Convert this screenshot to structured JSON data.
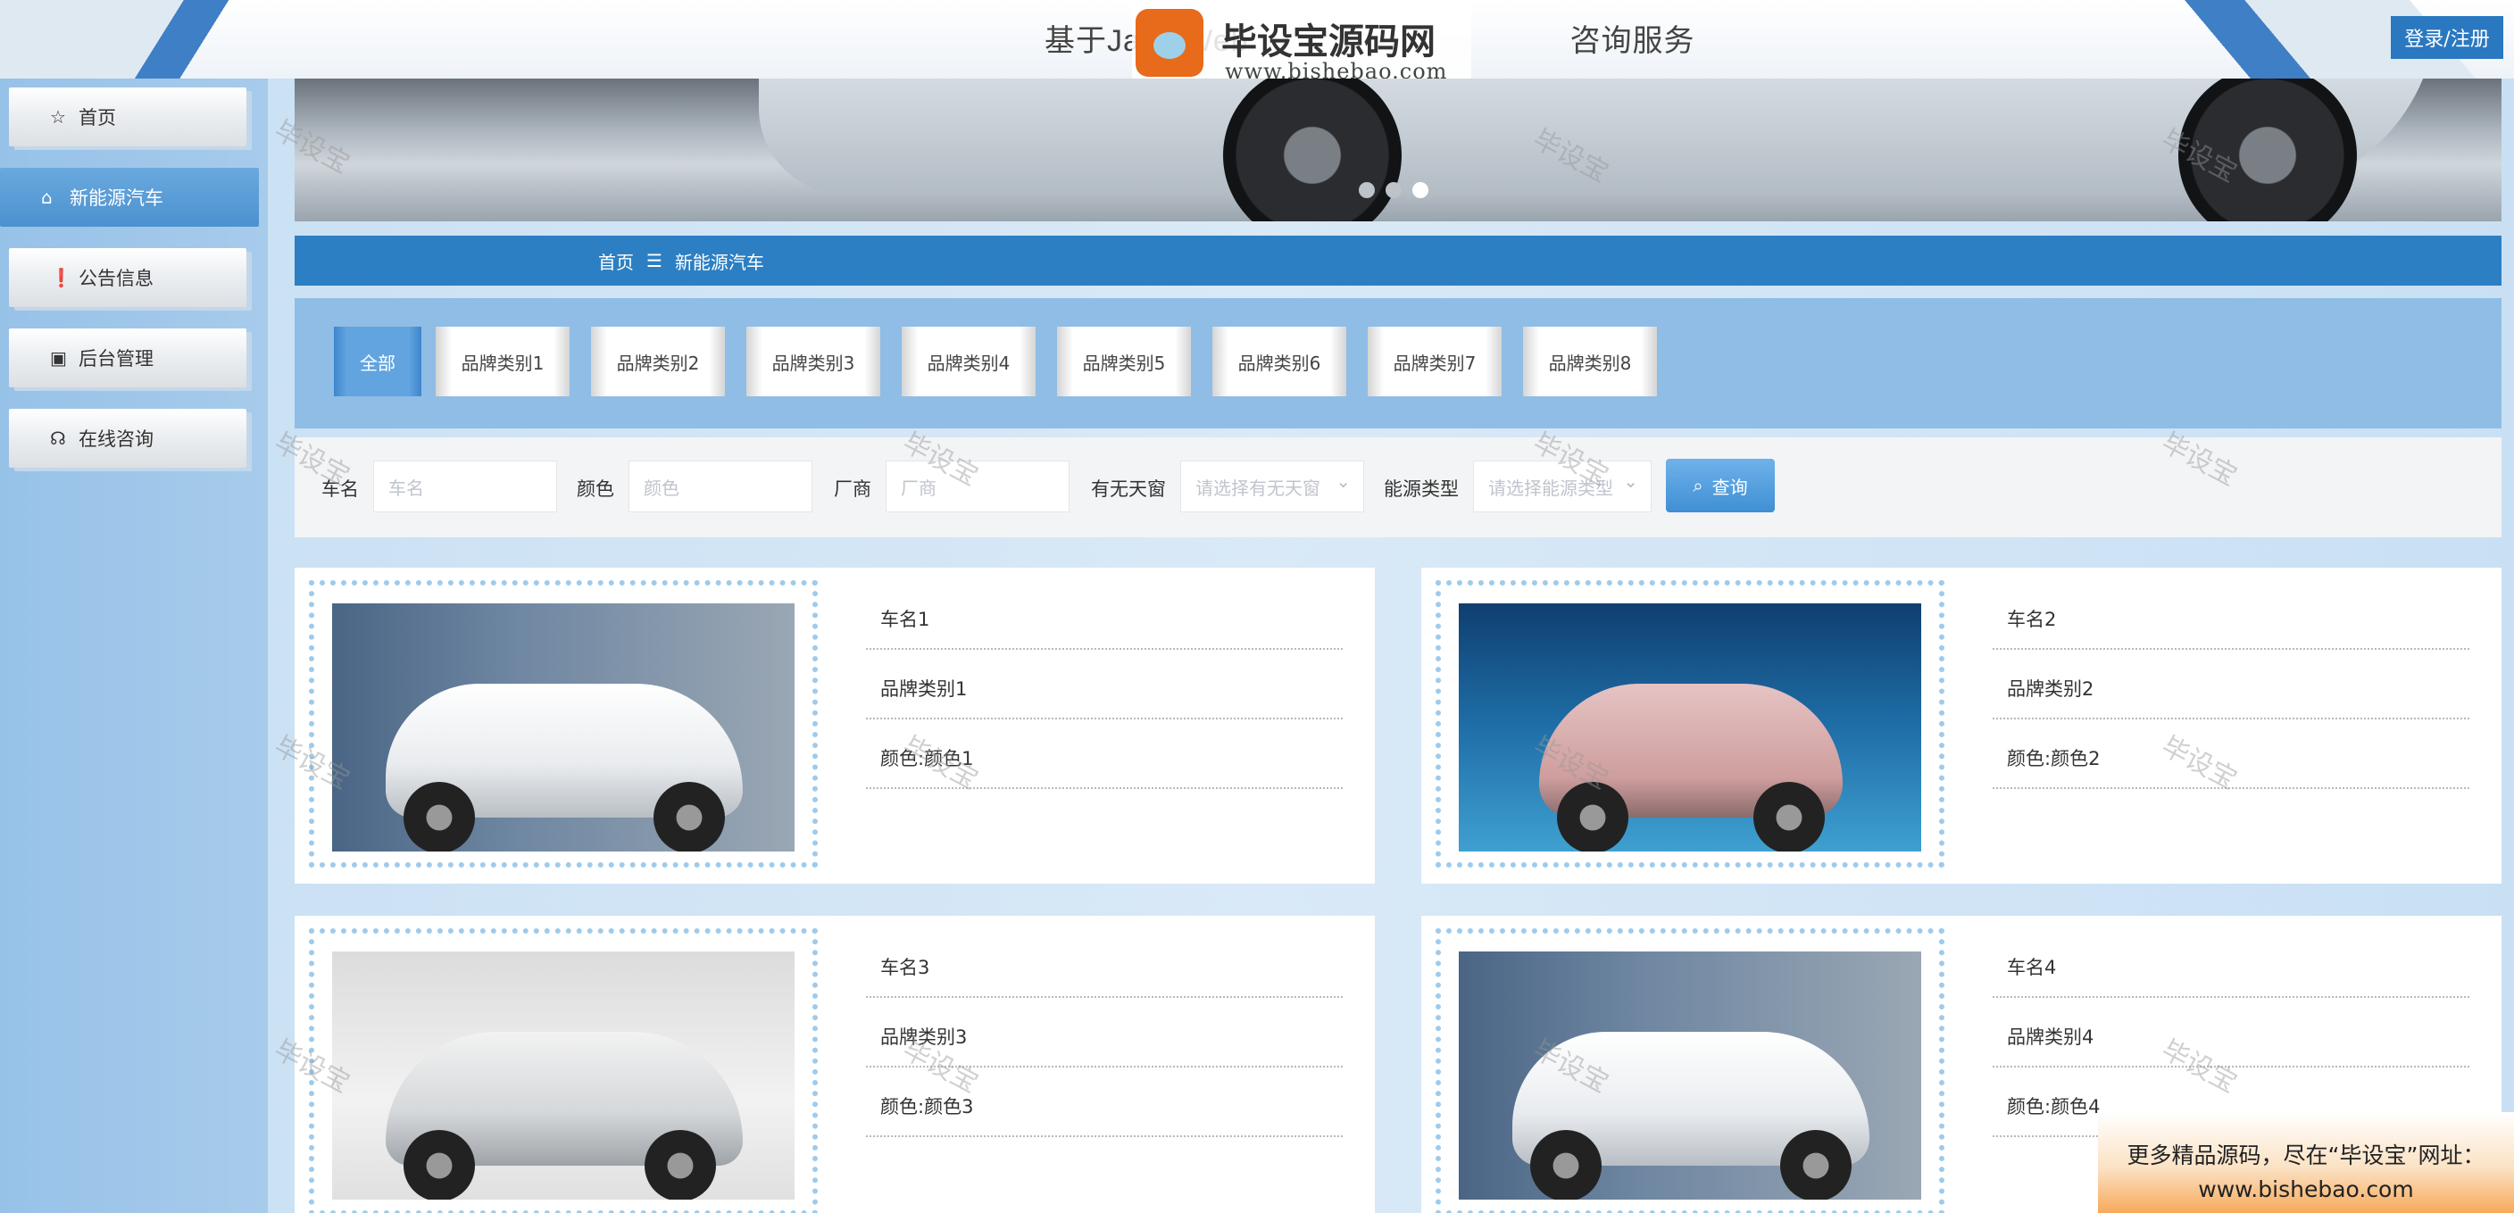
{
  "header": {
    "title": "基于Java Web",
    "title_tail": "咨询服务",
    "login_label": "登录/注册",
    "watermark_logo_text": "毕设宝源码网",
    "watermark_logo_url": "www.bishebao.com",
    "watermark_badge": "毕设宝"
  },
  "sidebar": {
    "items": [
      {
        "label": "首页",
        "icon": "star-icon",
        "active": false
      },
      {
        "label": "新能源汽车",
        "icon": "home-icon",
        "active": true
      },
      {
        "label": "公告信息",
        "icon": "alert-circle-icon",
        "active": false
      },
      {
        "label": "后台管理",
        "icon": "briefcase-icon",
        "active": false
      },
      {
        "label": "在线咨询",
        "icon": "headset-icon",
        "active": false
      }
    ]
  },
  "breadcrumb": {
    "home": "首页",
    "separator": "☰",
    "current": "新能源汽车"
  },
  "categories": [
    "全部",
    "品牌类别1",
    "品牌类别2",
    "品牌类别3",
    "品牌类别4",
    "品牌类别5",
    "品牌类别6",
    "品牌类别7",
    "品牌类别8"
  ],
  "search": {
    "name_label": "车名",
    "name_placeholder": "车名",
    "color_label": "颜色",
    "color_placeholder": "颜色",
    "maker_label": "厂商",
    "maker_placeholder": "厂商",
    "sunroof_label": "有无天窗",
    "sunroof_placeholder": "请选择有无天窗",
    "energy_label": "能源类型",
    "energy_placeholder": "请选择能源类型",
    "button_label": "查询"
  },
  "cards": [
    {
      "name": "车名1",
      "brand": "品牌类别1",
      "color": "颜色:颜色1"
    },
    {
      "name": "车名2",
      "brand": "品牌类别2",
      "color": "颜色:颜色2"
    },
    {
      "name": "车名3",
      "brand": "品牌类别3",
      "color": "颜色:颜色3"
    },
    {
      "name": "车名4",
      "brand": "品牌类别4",
      "color": "颜色:颜色4"
    }
  ],
  "watermark": "毕设宝",
  "promo": {
    "line1": "更多精品源码，尽在“毕设宝”网址：",
    "line2": "www.bishebao.com"
  },
  "carousel": {
    "count": 3,
    "active_index": 2
  },
  "colors": {
    "primary": "#2d7fc3",
    "sidebar": "#97c2e8",
    "active_nav": "#4b91d0"
  }
}
